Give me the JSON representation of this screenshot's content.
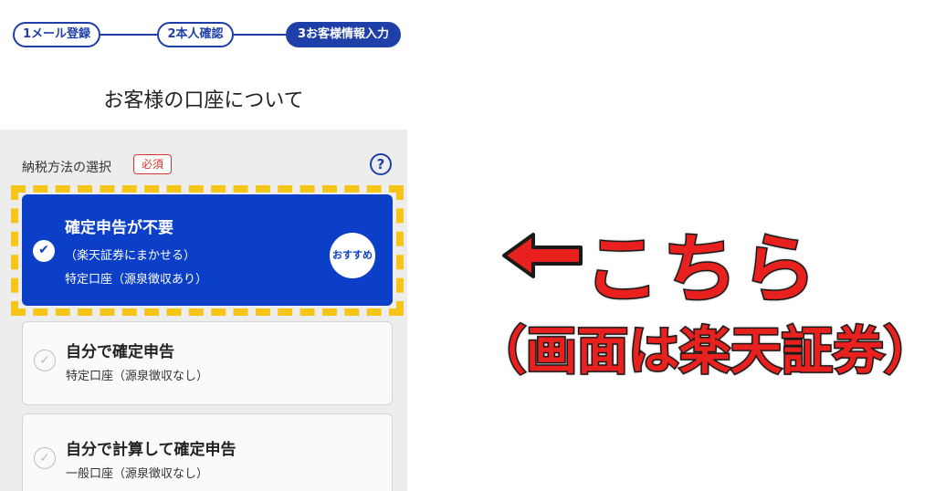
{
  "stepper": {
    "steps": [
      {
        "label": "1メール登録",
        "active": false
      },
      {
        "label": "2本人確認",
        "active": false
      },
      {
        "label": "3お客様情報入力",
        "active": true
      }
    ]
  },
  "page": {
    "title": "お客様の口座について"
  },
  "tax_method": {
    "label": "納税方法の選択",
    "required_badge": "必須",
    "help_icon": "?"
  },
  "options": [
    {
      "title": "確定申告が不要",
      "sub1": "（楽天証券にまかせる）",
      "sub2": "特定口座（源泉徴収あり）",
      "badge": "おすすめ",
      "selected": true
    },
    {
      "title": "自分で確定申告",
      "sub1": "特定口座（源泉徴収なし）",
      "selected": false
    },
    {
      "title": "自分で計算して確定申告",
      "sub1": "一般口座（源泉徴収なし）",
      "selected": false
    }
  ],
  "annotation": {
    "main": "こちら",
    "sub": "（画面は楽天証券）"
  },
  "colors": {
    "brand_blue": "#0b3fc7",
    "stepper_blue": "#1f3fa8",
    "required_red": "#d9342b",
    "highlight_yellow": "#f5c518",
    "annotation_red": "#e8211f"
  }
}
